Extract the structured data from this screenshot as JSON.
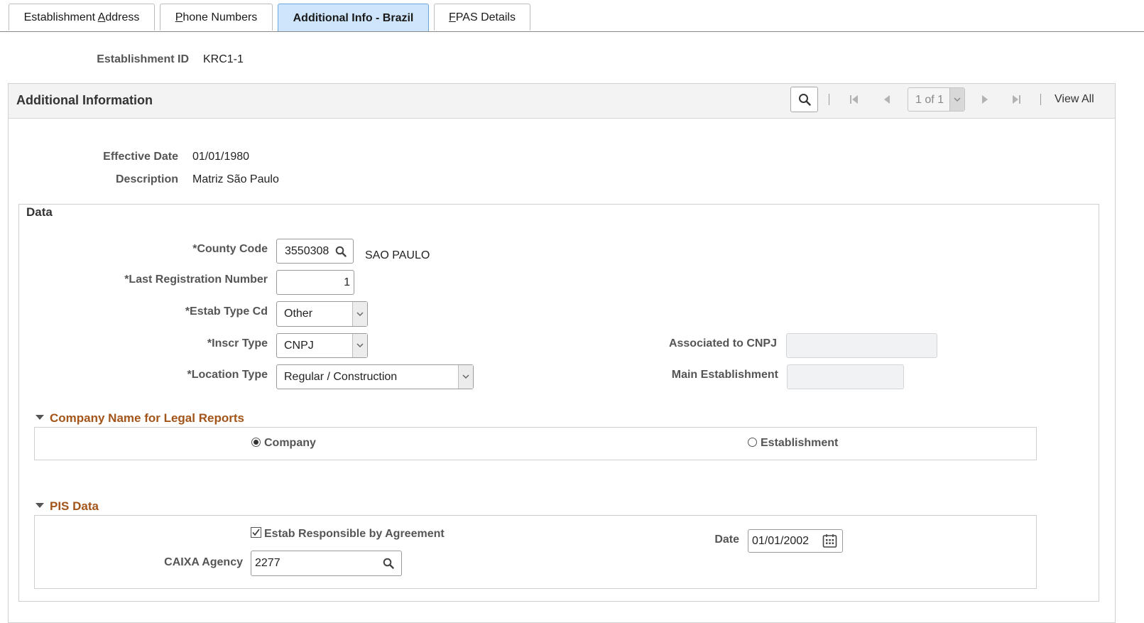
{
  "tabs": [
    {
      "pre": "Establishment ",
      "u": "A",
      "post": "ddress"
    },
    {
      "pre": "",
      "u": "P",
      "post": "hone Numbers"
    },
    {
      "pre": "Additional Info - Brazil",
      "u": "",
      "post": ""
    },
    {
      "pre": "",
      "u": "F",
      "post": "PAS Details"
    }
  ],
  "header": {
    "establishment_id_label": "Establishment ID",
    "establishment_id_value": "KRC1-1"
  },
  "grid": {
    "title": "Additional Information",
    "pager": "1 of 1",
    "view_all": "View All"
  },
  "record": {
    "effective_date_label": "Effective Date",
    "effective_date_value": "01/01/1980",
    "description_label": "Description",
    "description_value": "Matriz São Paulo"
  },
  "data_section": {
    "title": "Data",
    "county_code_label": "*County Code",
    "county_code_value": "3550308",
    "county_name": "SAO PAULO",
    "last_reg_label": "*Last Registration Number",
    "last_reg_value": "1",
    "estab_type_label": "*Estab Type Cd",
    "estab_type_value": "Other",
    "inscr_type_label": "*Inscr Type",
    "inscr_type_value": "CNPJ",
    "location_type_label": "*Location Type",
    "location_type_value": "Regular / Construction",
    "assoc_cnpj_label": "Associated to CNPJ",
    "assoc_cnpj_value": "",
    "main_estab_label": "Main Establishment",
    "main_estab_value": ""
  },
  "company_name_section": {
    "title": "Company Name for Legal Reports",
    "option_company": "Company",
    "option_establishment": "Establishment",
    "selected": "Company"
  },
  "pis_section": {
    "title": "PIS Data",
    "responsible_label": "Estab Responsible by Agreement",
    "responsible_checked": true,
    "date_label": "Date",
    "date_value": "01/01/2002",
    "caixa_label": "CAIXA Agency",
    "caixa_value": "2277"
  },
  "icons": {
    "search": "search-icon",
    "calendar": "calendar-icon",
    "dropdown": "chevron-down-icon",
    "first": "first-page-icon",
    "prev": "previous-icon",
    "next": "next-icon",
    "last": "last-page-icon"
  }
}
